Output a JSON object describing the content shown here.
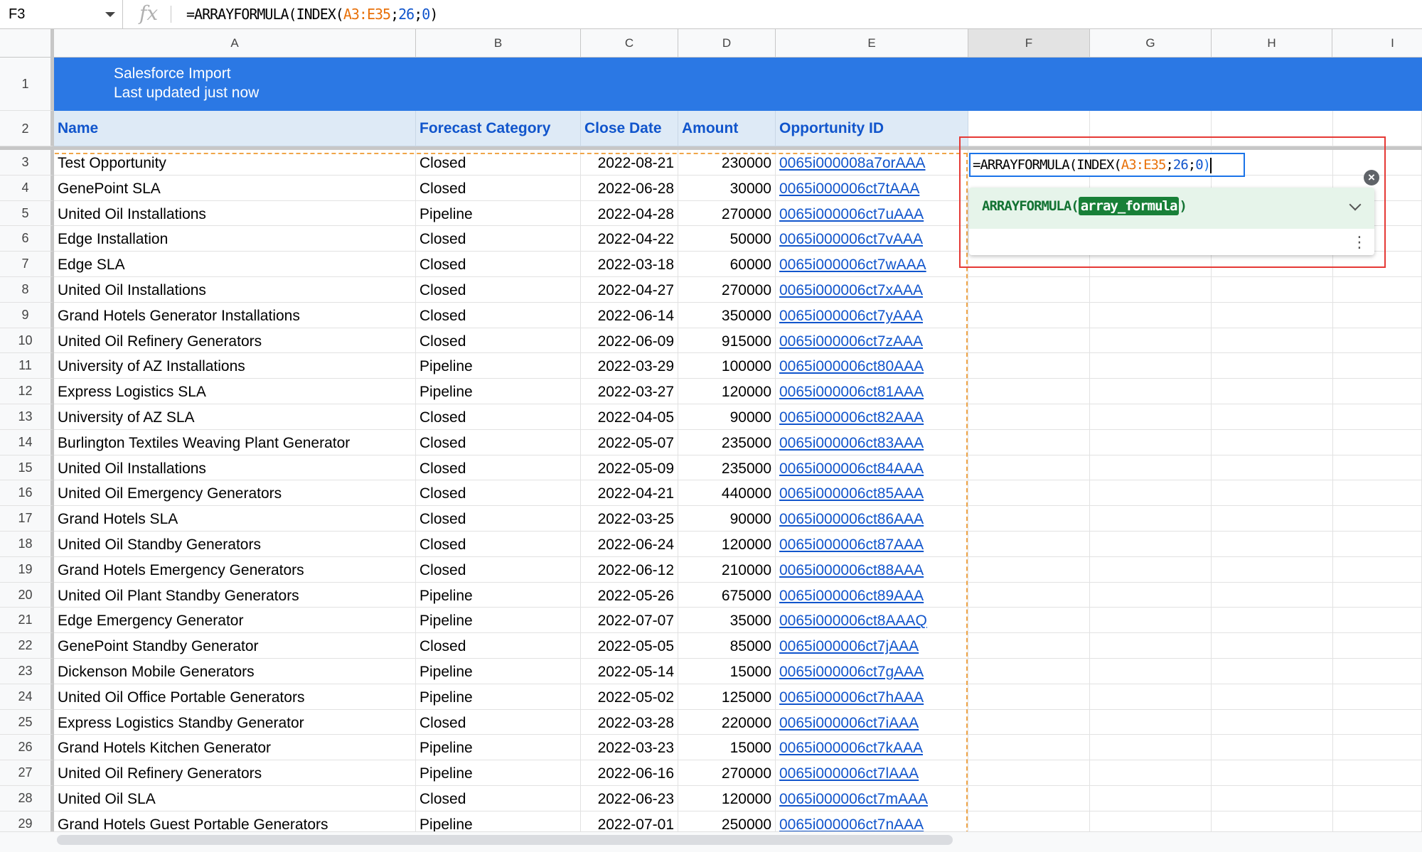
{
  "formula_bar": {
    "cell_ref": "F3",
    "fx_label": "fx",
    "formula_parts": [
      "=ARRAYFORMULA(INDEX(",
      "A3:E35",
      ";",
      "26",
      ";",
      "0",
      ")"
    ]
  },
  "columns": [
    "A",
    "B",
    "C",
    "D",
    "E",
    "F",
    "G",
    "H",
    "I"
  ],
  "title": {
    "line1": "Salesforce Import",
    "line2": "Last updated just now"
  },
  "headers": [
    "Name",
    "Forecast Category",
    "Close Date",
    "Amount",
    "Opportunity ID"
  ],
  "rows": [
    {
      "n": "3",
      "name": "Test Opportunity",
      "cat": "Closed",
      "date": "2022-08-21",
      "amount": "230000",
      "id": "0065i000008a7orAAA"
    },
    {
      "n": "4",
      "name": "GenePoint SLA",
      "cat": "Closed",
      "date": "2022-06-28",
      "amount": "30000",
      "id": "0065i000006ct7tAAA"
    },
    {
      "n": "5",
      "name": "United Oil Installations",
      "cat": "Pipeline",
      "date": "2022-04-28",
      "amount": "270000",
      "id": "0065i000006ct7uAAA"
    },
    {
      "n": "6",
      "name": "Edge Installation",
      "cat": "Closed",
      "date": "2022-04-22",
      "amount": "50000",
      "id": "0065i000006ct7vAAA"
    },
    {
      "n": "7",
      "name": "Edge SLA",
      "cat": "Closed",
      "date": "2022-03-18",
      "amount": "60000",
      "id": "0065i000006ct7wAAA"
    },
    {
      "n": "8",
      "name": "United Oil Installations",
      "cat": "Closed",
      "date": "2022-04-27",
      "amount": "270000",
      "id": "0065i000006ct7xAAA"
    },
    {
      "n": "9",
      "name": "Grand Hotels Generator Installations",
      "cat": "Closed",
      "date": "2022-06-14",
      "amount": "350000",
      "id": "0065i000006ct7yAAA"
    },
    {
      "n": "10",
      "name": "United Oil Refinery Generators",
      "cat": "Closed",
      "date": "2022-06-09",
      "amount": "915000",
      "id": "0065i000006ct7zAAA"
    },
    {
      "n": "11",
      "name": "University of AZ Installations",
      "cat": "Pipeline",
      "date": "2022-03-29",
      "amount": "100000",
      "id": "0065i000006ct80AAA"
    },
    {
      "n": "12",
      "name": "Express Logistics SLA",
      "cat": "Pipeline",
      "date": "2022-03-27",
      "amount": "120000",
      "id": "0065i000006ct81AAA"
    },
    {
      "n": "13",
      "name": "University of AZ SLA",
      "cat": "Closed",
      "date": "2022-04-05",
      "amount": "90000",
      "id": "0065i000006ct82AAA"
    },
    {
      "n": "14",
      "name": "Burlington Textiles Weaving Plant Generator",
      "cat": "Closed",
      "date": "2022-05-07",
      "amount": "235000",
      "id": "0065i000006ct83AAA"
    },
    {
      "n": "15",
      "name": "United Oil Installations",
      "cat": "Closed",
      "date": "2022-05-09",
      "amount": "235000",
      "id": "0065i000006ct84AAA"
    },
    {
      "n": "16",
      "name": "United Oil Emergency Generators",
      "cat": "Closed",
      "date": "2022-04-21",
      "amount": "440000",
      "id": "0065i000006ct85AAA"
    },
    {
      "n": "17",
      "name": "Grand Hotels SLA",
      "cat": "Closed",
      "date": "2022-03-25",
      "amount": "90000",
      "id": "0065i000006ct86AAA"
    },
    {
      "n": "18",
      "name": "United Oil Standby Generators",
      "cat": "Closed",
      "date": "2022-06-24",
      "amount": "120000",
      "id": "0065i000006ct87AAA"
    },
    {
      "n": "19",
      "name": "Grand Hotels Emergency Generators",
      "cat": "Closed",
      "date": "2022-06-12",
      "amount": "210000",
      "id": "0065i000006ct88AAA"
    },
    {
      "n": "20",
      "name": "United Oil Plant Standby Generators",
      "cat": "Pipeline",
      "date": "2022-05-26",
      "amount": "675000",
      "id": "0065i000006ct89AAA"
    },
    {
      "n": "21",
      "name": "Edge Emergency Generator",
      "cat": "Pipeline",
      "date": "2022-07-07",
      "amount": "35000",
      "id": "0065i000006ct8AAAQ"
    },
    {
      "n": "22",
      "name": "GenePoint Standby Generator",
      "cat": "Closed",
      "date": "2022-05-05",
      "amount": "85000",
      "id": "0065i000006ct7jAAA"
    },
    {
      "n": "23",
      "name": "Dickenson Mobile Generators",
      "cat": "Pipeline",
      "date": "2022-05-14",
      "amount": "15000",
      "id": "0065i000006ct7gAAA"
    },
    {
      "n": "24",
      "name": "United Oil Office Portable Generators",
      "cat": "Pipeline",
      "date": "2022-05-02",
      "amount": "125000",
      "id": "0065i000006ct7hAAA"
    },
    {
      "n": "25",
      "name": "Express Logistics Standby Generator",
      "cat": "Closed",
      "date": "2022-03-28",
      "amount": "220000",
      "id": "0065i000006ct7iAAA"
    },
    {
      "n": "26",
      "name": "Grand Hotels Kitchen Generator",
      "cat": "Pipeline",
      "date": "2022-03-23",
      "amount": "15000",
      "id": "0065i000006ct7kAAA"
    },
    {
      "n": "27",
      "name": "United Oil Refinery Generators",
      "cat": "Pipeline",
      "date": "2022-06-16",
      "amount": "270000",
      "id": "0065i000006ct7lAAA"
    },
    {
      "n": "28",
      "name": "United Oil SLA",
      "cat": "Closed",
      "date": "2022-06-23",
      "amount": "120000",
      "id": "0065i000006ct7mAAA"
    },
    {
      "n": "29",
      "name": "Grand Hotels Guest Portable Generators",
      "cat": "Pipeline",
      "date": "2022-07-01",
      "amount": "250000",
      "id": "0065i000006ct7nAAA"
    }
  ],
  "editor": {
    "formula_parts": [
      "=ARRAYFORMULA(INDEX(",
      "A3:E35",
      ";",
      "26",
      ";",
      "0",
      ")"
    ]
  },
  "autocomplete": {
    "fn_name": "ARRAYFORMULA(",
    "arg": "array_formula",
    "close": ")"
  },
  "colors": {
    "title_bg": "#2b78e4",
    "header_bg": "#deeaf6",
    "link": "#1155cc",
    "highlight": "#e53935"
  }
}
